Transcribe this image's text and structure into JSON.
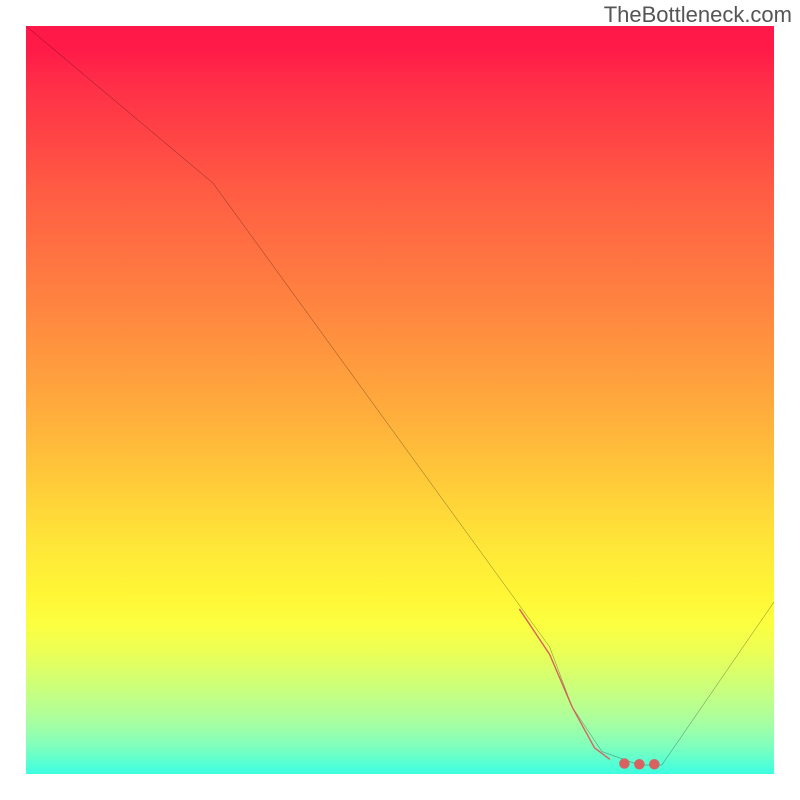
{
  "watermark": "TheBottleneck.com",
  "chart_data": {
    "type": "line",
    "title": "",
    "xlabel": "",
    "ylabel": "",
    "xlim": [
      0,
      100
    ],
    "ylim": [
      0,
      100
    ],
    "grid": false,
    "series": [
      {
        "name": "bottleneck-curve",
        "color": "#000000",
        "width": 2,
        "x": [
          0,
          25,
          70,
          73,
          77,
          82,
          85,
          100
        ],
        "values": [
          100,
          79,
          17,
          9,
          3,
          1.2,
          1.2,
          23
        ]
      },
      {
        "name": "optimal-range-marker",
        "color": "#d86262",
        "width": 10,
        "style": "solid-then-dotted",
        "x": [
          66,
          70,
          73,
          76,
          78,
          80,
          82,
          84
        ],
        "values": [
          22,
          16,
          9,
          3.5,
          2,
          1.4,
          1.3,
          1.3
        ]
      }
    ],
    "annotations": []
  }
}
